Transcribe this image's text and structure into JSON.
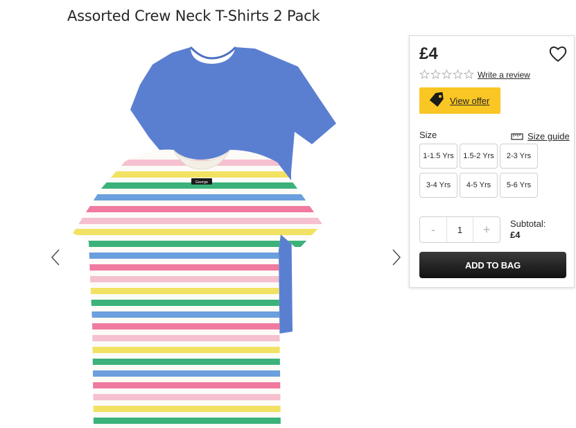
{
  "product": {
    "title": "Assorted Crew Neck T-Shirts 2 Pack",
    "neck_label_text": "George"
  },
  "gallery": {
    "prev_icon": "chevron-left-icon",
    "next_icon": "chevron-right-icon"
  },
  "panel": {
    "price": "£4",
    "wishlist_icon": "heart-icon",
    "rating_stars": 0,
    "rating_max": 5,
    "write_review": "Write a review",
    "offer": {
      "label": "View offer",
      "icon": "tag-icon"
    },
    "size_label": "Size",
    "size_guide": {
      "label": "Size guide",
      "icon": "ruler-icon"
    },
    "sizes": [
      "1-1.5 Yrs",
      "1.5-2 Yrs",
      "2-3 Yrs",
      "3-4 Yrs",
      "4-5 Yrs",
      "5-6 Yrs"
    ],
    "quantity": {
      "minus": "-",
      "value": "1",
      "plus": "+"
    },
    "subtotal_label": "Subtotal:",
    "subtotal_value": "£4",
    "add_to_bag": "ADD TO BAG"
  },
  "colors": {
    "offer_yellow": "#f9c623",
    "blue_shirt": "#5b7fd0",
    "stripe_colors": [
      "#f07aa0",
      "#f5c0cf",
      "#f1e264",
      "#3bb27a",
      "#6b9fde"
    ],
    "button_dark": "#1c1c1c"
  }
}
